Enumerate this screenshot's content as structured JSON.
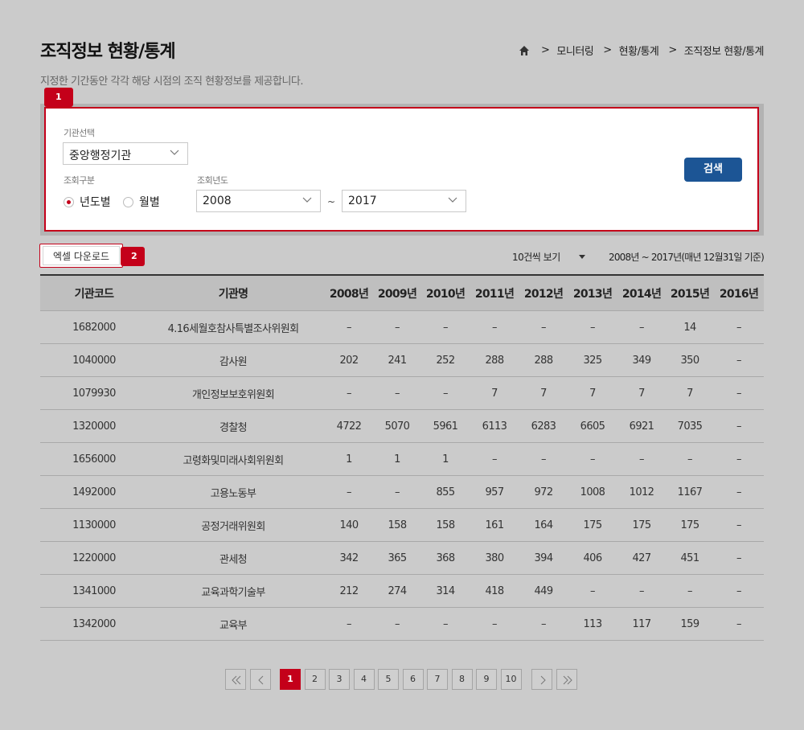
{
  "page": {
    "title": "조직정보 현황/통계",
    "subtitle": "지정한 기간동안 각각 해당 시점의 조직 현황정보를 제공합니다."
  },
  "breadcrumb": {
    "home_icon": "home-icon",
    "items": [
      ">",
      "모니터링",
      ">",
      "현황/통계",
      ">",
      "조직정보 현황/통계"
    ]
  },
  "callouts": [
    "1",
    "2"
  ],
  "search": {
    "agency_label": "기관선택",
    "agency_value": "중앙행정기관",
    "type_label": "조회구분",
    "type_options": [
      "년도별",
      "월별"
    ],
    "type_selected": "년도별",
    "year_label": "조회년도",
    "year_from": "2008",
    "year_to": "2017",
    "range_sep": "~",
    "search_button": "검색",
    "accent_color": "#c4001a",
    "button_color": "#1c5595"
  },
  "toolbar": {
    "excel_button": "엑셀 다운로드",
    "per_page": "10건씩 보기",
    "basis": "2008년 ~ 2017년(매년 12월31일 기준)"
  },
  "table": {
    "headers": [
      "기관코드",
      "기관명",
      "2008년",
      "2009년",
      "2010년",
      "2011년",
      "2012년",
      "2013년",
      "2014년",
      "2015년",
      "2016년"
    ],
    "rows": [
      [
        "1682000",
        "4.16세월호참사특별조사위원회",
        "–",
        "–",
        "–",
        "–",
        "–",
        "–",
        "–",
        "14",
        "–"
      ],
      [
        "1040000",
        "감사원",
        "202",
        "241",
        "252",
        "288",
        "288",
        "325",
        "349",
        "350",
        "–"
      ],
      [
        "1079930",
        "개인정보보호위원회",
        "–",
        "–",
        "–",
        "7",
        "7",
        "7",
        "7",
        "7",
        "–"
      ],
      [
        "1320000",
        "경찰청",
        "4722",
        "5070",
        "5961",
        "6113",
        "6283",
        "6605",
        "6921",
        "7035",
        "–"
      ],
      [
        "1656000",
        "고령화및미래사회위원회",
        "1",
        "1",
        "1",
        "–",
        "–",
        "–",
        "–",
        "–",
        "–"
      ],
      [
        "1492000",
        "고용노동부",
        "–",
        "–",
        "855",
        "957",
        "972",
        "1008",
        "1012",
        "1167",
        "–"
      ],
      [
        "1130000",
        "공정거래위원회",
        "140",
        "158",
        "158",
        "161",
        "164",
        "175",
        "175",
        "175",
        "–"
      ],
      [
        "1220000",
        "관세청",
        "342",
        "365",
        "368",
        "380",
        "394",
        "406",
        "427",
        "451",
        "–"
      ],
      [
        "1341000",
        "교육과학기술부",
        "212",
        "274",
        "314",
        "418",
        "449",
        "–",
        "–",
        "–",
        "–"
      ],
      [
        "1342000",
        "교육부",
        "–",
        "–",
        "–",
        "–",
        "–",
        "113",
        "117",
        "159",
        "–"
      ]
    ]
  },
  "pagination": {
    "pages": [
      "1",
      "2",
      "3",
      "4",
      "5",
      "6",
      "7",
      "8",
      "9",
      "10"
    ],
    "current": "1",
    "icons": [
      "double-chevron-left-icon",
      "chevron-left-icon",
      "chevron-right-icon",
      "double-chevron-right-icon"
    ]
  }
}
